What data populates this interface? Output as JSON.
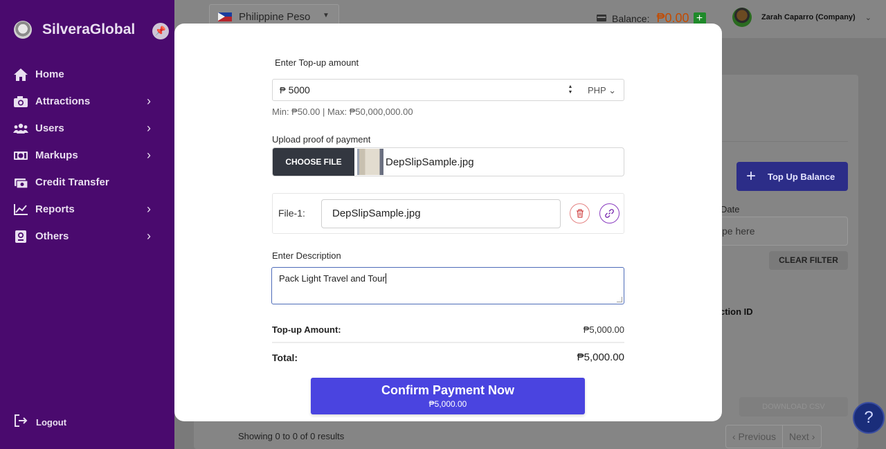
{
  "app": {
    "brand": "SilveraGlobal"
  },
  "sidebar": {
    "items": [
      {
        "label": "Home",
        "icon": "home-icon",
        "has_submenu": false
      },
      {
        "label": "Attractions",
        "icon": "camera-icon",
        "has_submenu": true
      },
      {
        "label": "Users",
        "icon": "users-icon",
        "has_submenu": true
      },
      {
        "label": "Markups",
        "icon": "money-icon",
        "has_submenu": true
      },
      {
        "label": "Credit Transfer",
        "icon": "transfer-icon",
        "has_submenu": false
      },
      {
        "label": "Reports",
        "icon": "chart-icon",
        "has_submenu": true
      },
      {
        "label": "Others",
        "icon": "passport-icon",
        "has_submenu": true
      }
    ],
    "logout_label": "Logout"
  },
  "header": {
    "currency": "Philippine Peso",
    "balance_label": "Balance:",
    "balance_value": "₱0.00",
    "user_name": "Zarah Caparro (Company)"
  },
  "background": {
    "topup_button": "Top Up Balance",
    "date_label": "Date",
    "date_placeholder": "pe here",
    "clear_filter": "CLEAR FILTER",
    "column_transaction_id": "ction ID",
    "download_csv": "DOWNLOAD CSV",
    "showing": "Showing 0 to 0 of 0 results",
    "prev": "‹ Previous",
    "next": "Next ›"
  },
  "modal": {
    "amount_label": "Enter Top-up amount",
    "amount_value": "5000",
    "currency_symbol": "₱",
    "currency_code": "PHP",
    "amount_hint": "Min: ₱50.00 | Max: ₱50,000,000.00",
    "upload_label": "Upload proof of payment",
    "choose_file": "CHOOSE FILE",
    "chosen_file": "DepSlipSample.jpg",
    "file_row_label": "File-1:",
    "file_row_value": "DepSlipSample.jpg",
    "description_label": "Enter Description",
    "description_value": "Pack Light Travel and Tour",
    "topup_amount_label": "Top-up Amount:",
    "topup_amount_value": "₱5,000.00",
    "total_label": "Total:",
    "total_value": "₱5,000.00",
    "confirm_title": "Confirm Payment Now",
    "confirm_amount": "₱5,000.00"
  },
  "colors": {
    "sidebar": "#4a0a6e",
    "primary": "#4a44e0",
    "balance": "#c34b00"
  }
}
